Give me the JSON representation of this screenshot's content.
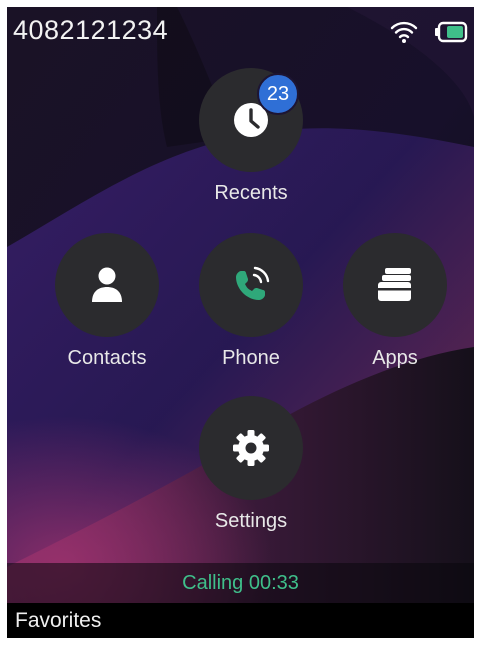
{
  "status_bar": {
    "phone_number": "4082121234",
    "wifi_icon": "wifi-icon",
    "battery_icon": "battery-icon"
  },
  "menu": {
    "recents": {
      "label": "Recents",
      "icon": "clock-icon",
      "badge": "23"
    },
    "contacts": {
      "label": "Contacts",
      "icon": "person-icon"
    },
    "phone": {
      "label": "Phone",
      "icon": "phone-active-icon"
    },
    "apps": {
      "label": "Apps",
      "icon": "stacked-cards-icon"
    },
    "settings": {
      "label": "Settings",
      "icon": "gear-icon"
    }
  },
  "call_status": "Calling 00:33",
  "bottom_bar": {
    "softkey_label": "Favorites"
  },
  "colors": {
    "badge": "#2f6fd6",
    "call_status": "#3fbf8a",
    "phone_icon": "#2fa87a",
    "battery_fill": "#3fbf8a"
  }
}
